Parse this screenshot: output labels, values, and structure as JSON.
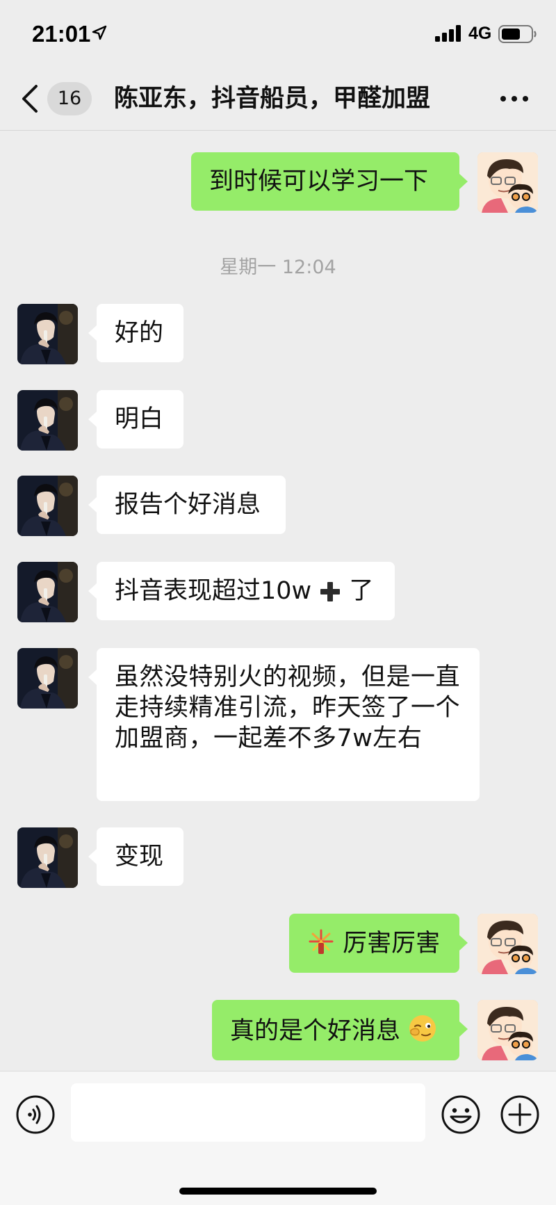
{
  "status_bar": {
    "time": "21:01",
    "network": "4G"
  },
  "nav": {
    "unread_count": "16",
    "title": "陈亚东，抖音船员，甲醛加盟"
  },
  "messages": [
    {
      "side": "out",
      "text": "到时候可以学习一下"
    },
    {
      "type": "timestamp",
      "text": "星期一 12:04"
    },
    {
      "side": "in",
      "text": "好的"
    },
    {
      "side": "in",
      "text": "明白"
    },
    {
      "side": "in",
      "text": "报告个好消息"
    },
    {
      "side": "in",
      "text": "抖音表现超过10w",
      "suffix_icon": "heavy-plus-emoji",
      "suffix_text": "了"
    },
    {
      "side": "in",
      "text": "虽然没特别火的视频，但是一直走持续精准引流，昨天签了一个加盟商，一起差不多7w左右"
    },
    {
      "side": "in",
      "text": "变现"
    },
    {
      "side": "out",
      "text": "厉害厉害",
      "prefix_icon": "fireworks-emoji"
    },
    {
      "side": "out",
      "text": "真的是个好消息",
      "suffix_icon": "winking-ok-emoji"
    }
  ],
  "input": {
    "value": "",
    "placeholder": ""
  },
  "colors": {
    "background": "#ededed",
    "outgoing_bubble": "#95ec69",
    "incoming_bubble": "#ffffff",
    "timestamp": "#a3a3a3"
  }
}
